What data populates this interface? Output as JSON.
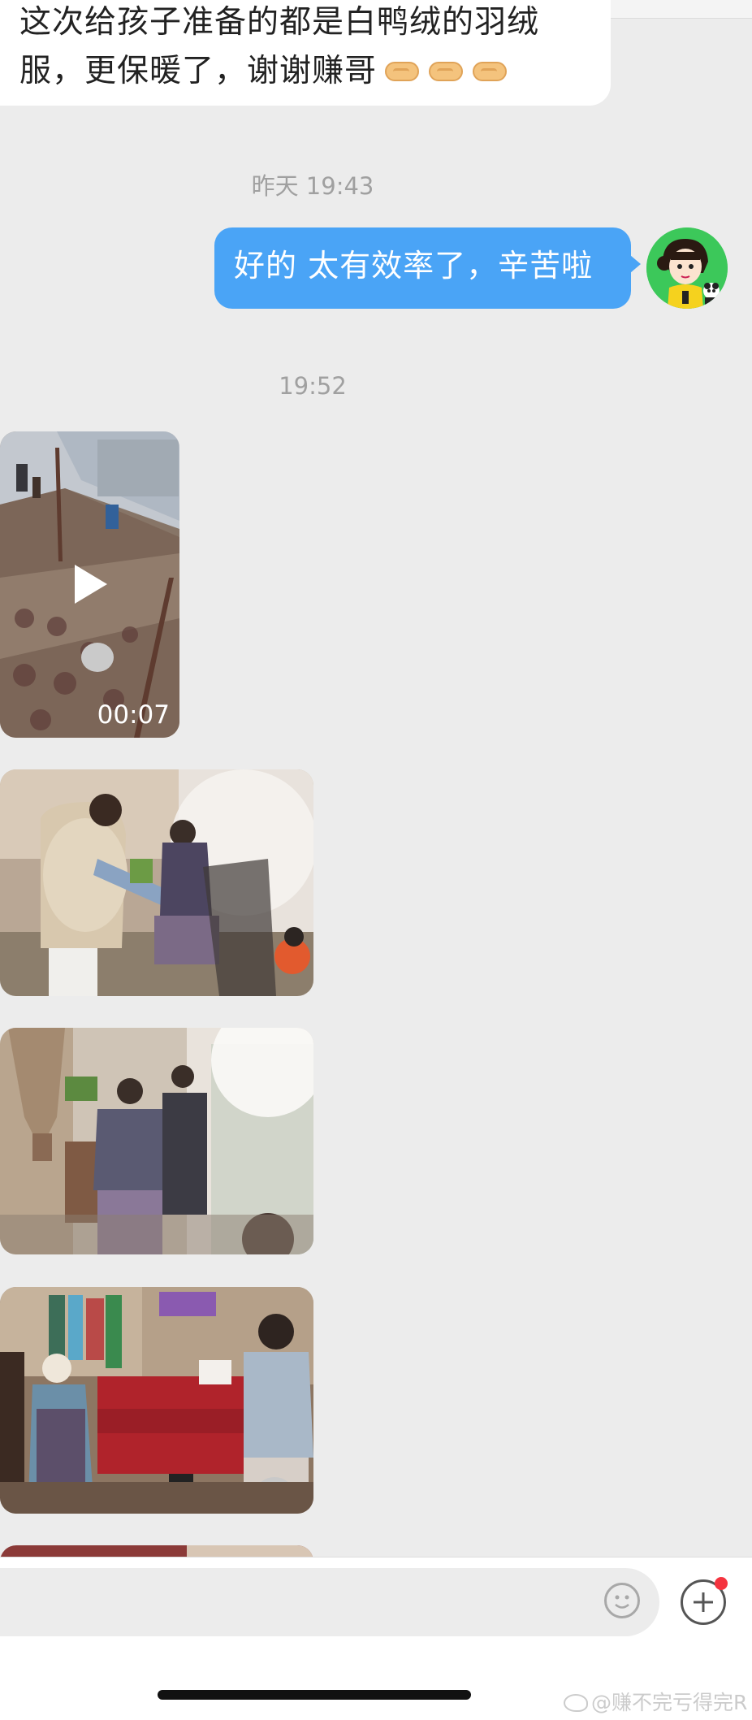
{
  "incoming_message": {
    "line1": "这次给孩子准备的都是白鸭绒的羽绒",
    "line2": "服，更保暖了，谢谢赚哥",
    "emoji": "handshake-icon"
  },
  "timestamp_1": "昨天 19:43",
  "outgoing_message": {
    "text": "好的 太有效率了，辛苦啦"
  },
  "timestamp_2": "19:52",
  "video": {
    "duration": "00:07",
    "icon": "play-icon"
  },
  "input_bar": {
    "emoji_icon": "smiley-icon",
    "more_icon": "plus-circle-icon",
    "badge_color": "#f5333f"
  },
  "watermark": "@赚不完亏得完R",
  "colors": {
    "bubble_out": "#4aa4f6",
    "background": "#ececec"
  }
}
